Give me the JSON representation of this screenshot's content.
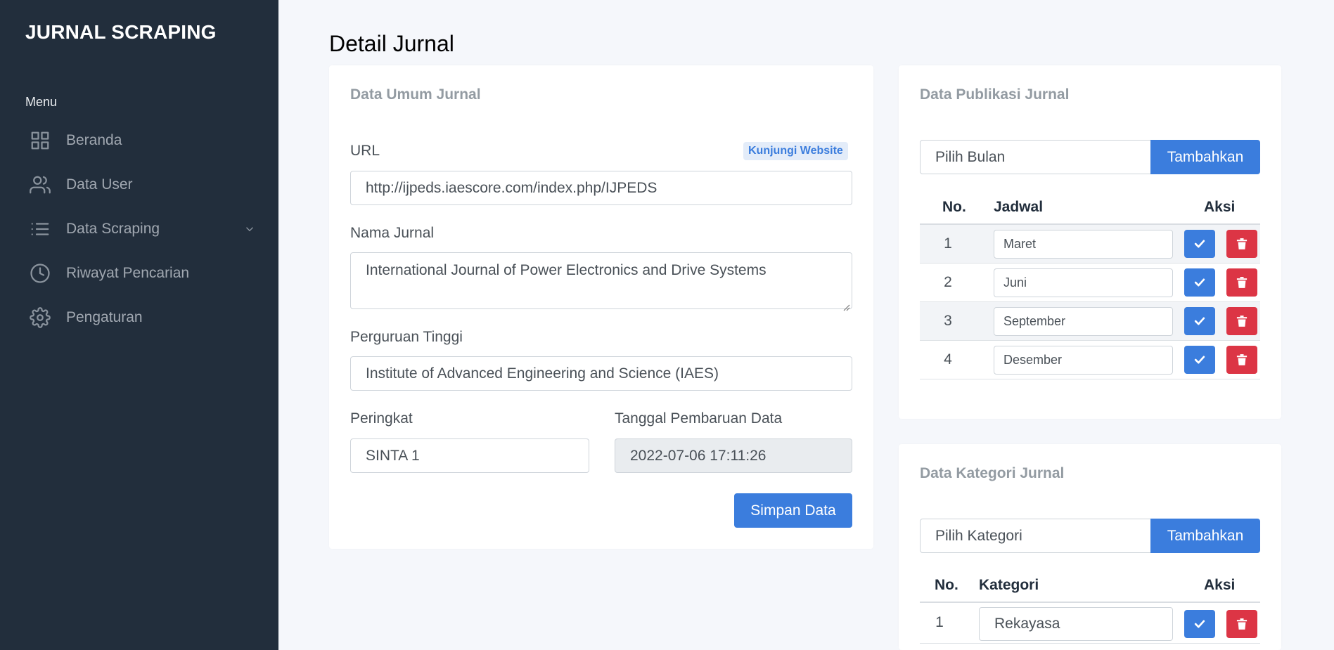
{
  "sidebar": {
    "brand": "JURNAL SCRAPING",
    "menu_header": "Menu",
    "items": [
      {
        "label": "Beranda",
        "icon": "grid-icon"
      },
      {
        "label": "Data User",
        "icon": "users-icon"
      },
      {
        "label": "Data Scraping",
        "icon": "list-icon",
        "has_caret": true
      },
      {
        "label": "Riwayat Pencarian",
        "icon": "clock-icon"
      },
      {
        "label": "Pengaturan",
        "icon": "settings-icon"
      }
    ]
  },
  "page_title": "Detail Jurnal",
  "general_card": {
    "title": "Data Umum Jurnal",
    "url_label": "URL",
    "visit_link": "Kunjungi Website",
    "url_value": "http://ijpeds.iaescore.com/index.php/IJPEDS",
    "name_label": "Nama Jurnal",
    "name_value": "International Journal of Power Electronics and Drive Systems",
    "university_label": "Perguruan Tinggi",
    "university_value": "Institute of Advanced Engineering and Science (IAES)",
    "rank_label": "Peringkat",
    "rank_value": "SINTA 1",
    "updated_label": "Tanggal Pembaruan Data",
    "updated_value": "2022-07-06 17:11:26",
    "save_button": "Simpan Data"
  },
  "publication_card": {
    "title": "Data Publikasi Jurnal",
    "select_placeholder": "Pilih Bulan",
    "add_button": "Tambahkan",
    "headers": {
      "no": "No.",
      "schedule": "Jadwal",
      "action": "Aksi"
    },
    "rows": [
      {
        "no": "1",
        "value": "Maret"
      },
      {
        "no": "2",
        "value": "Juni"
      },
      {
        "no": "3",
        "value": "September"
      },
      {
        "no": "4",
        "value": "Desember"
      }
    ]
  },
  "category_card": {
    "title": "Data Kategori Jurnal",
    "select_placeholder": "Pilih Kategori",
    "add_button": "Tambahkan",
    "headers": {
      "no": "No.",
      "category": "Kategori",
      "action": "Aksi"
    },
    "rows": [
      {
        "no": "1",
        "value": "Rekayasa"
      }
    ]
  },
  "colors": {
    "sidebar_bg": "#222e3c",
    "primary": "#3b7ddd",
    "danger": "#dc3545",
    "page_bg": "#f5f7fb"
  }
}
